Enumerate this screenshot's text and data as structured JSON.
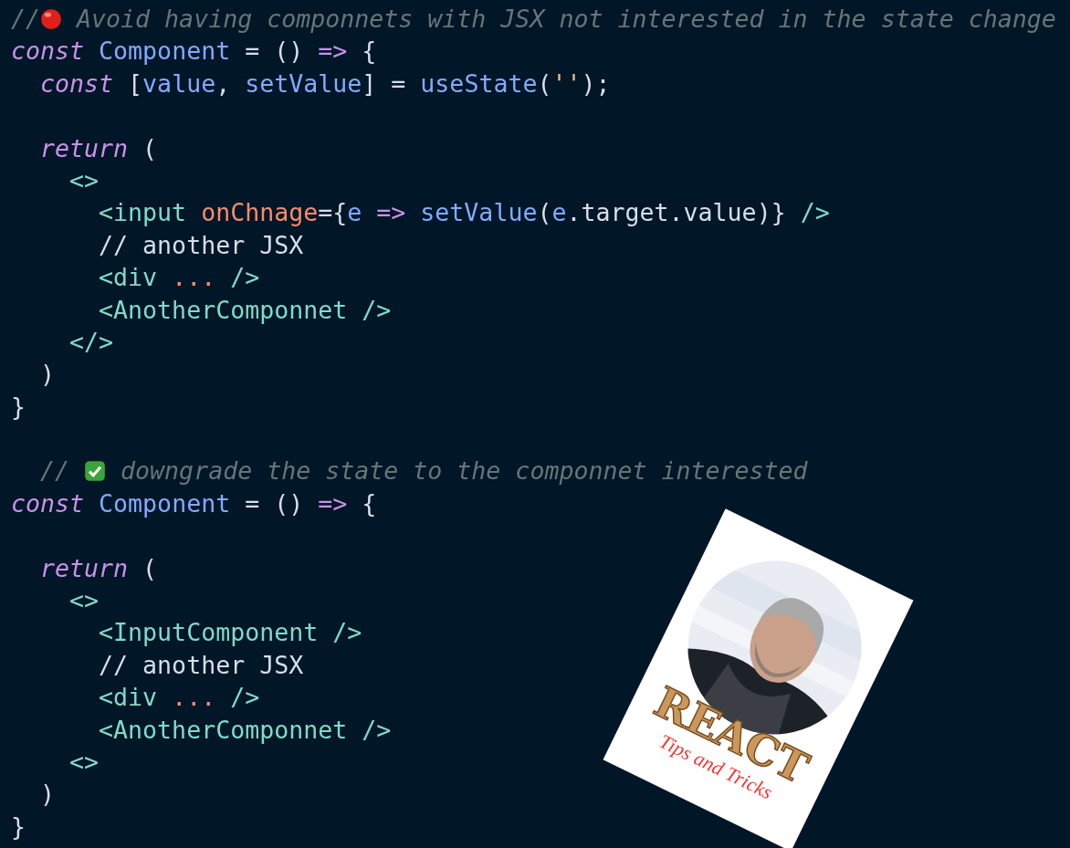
{
  "code_lines": [
    {
      "kind": "code",
      "tokens": [
        {
          "kind": "comment",
          "text": "//"
        },
        {
          "kind": "red-dot"
        },
        {
          "kind": "comment",
          "text": " Avoid having componnets with JSX not interested in the state change"
        }
      ]
    },
    {
      "kind": "code",
      "tokens": [
        {
          "kind": "keyword",
          "text": "const"
        },
        {
          "kind": "name",
          "text": " Component"
        },
        {
          "kind": "punct",
          "text": " = () "
        },
        {
          "kind": "keyword-plain",
          "text": "=>"
        },
        {
          "kind": "punct",
          "text": " {"
        }
      ]
    },
    {
      "kind": "code",
      "tokens": [
        {
          "kind": "keyword",
          "text": "  const"
        },
        {
          "kind": "punct",
          "text": " ["
        },
        {
          "kind": "name",
          "text": "value"
        },
        {
          "kind": "punct",
          "text": ", "
        },
        {
          "kind": "name",
          "text": "setValue"
        },
        {
          "kind": "punct",
          "text": "] = "
        },
        {
          "kind": "name",
          "text": "useState"
        },
        {
          "kind": "punct",
          "text": "("
        },
        {
          "kind": "string",
          "text": "''"
        },
        {
          "kind": "punct",
          "text": ");"
        }
      ]
    },
    {
      "kind": "blank"
    },
    {
      "kind": "code",
      "tokens": [
        {
          "kind": "keyword",
          "text": "  return"
        },
        {
          "kind": "punct",
          "text": " ("
        }
      ]
    },
    {
      "kind": "code",
      "tokens": [
        {
          "kind": "tag",
          "text": "    <>"
        }
      ]
    },
    {
      "kind": "code",
      "tokens": [
        {
          "kind": "tag",
          "text": "      <input "
        },
        {
          "kind": "attr",
          "text": "onChnage"
        },
        {
          "kind": "punct",
          "text": "={"
        },
        {
          "kind": "name",
          "text": "e"
        },
        {
          "kind": "keyword-plain",
          "text": " => "
        },
        {
          "kind": "name",
          "text": "setValue"
        },
        {
          "kind": "punct",
          "text": "("
        },
        {
          "kind": "name",
          "text": "e"
        },
        {
          "kind": "punct",
          "text": "."
        },
        {
          "kind": "plain",
          "text": "target"
        },
        {
          "kind": "punct",
          "text": "."
        },
        {
          "kind": "plain",
          "text": "value"
        },
        {
          "kind": "punct",
          "text": ")} "
        },
        {
          "kind": "tag",
          "text": "/>"
        }
      ]
    },
    {
      "kind": "code",
      "tokens": [
        {
          "kind": "plain",
          "text": "      // another JSX"
        }
      ]
    },
    {
      "kind": "code",
      "tokens": [
        {
          "kind": "tag",
          "text": "      <div "
        },
        {
          "kind": "attr",
          "text": "..."
        },
        {
          "kind": "tag",
          "text": " />"
        }
      ]
    },
    {
      "kind": "code",
      "tokens": [
        {
          "kind": "tag",
          "text": "      <AnotherComponnet />"
        }
      ]
    },
    {
      "kind": "code",
      "tokens": [
        {
          "kind": "tag",
          "text": "    </>"
        }
      ]
    },
    {
      "kind": "code",
      "tokens": [
        {
          "kind": "punct",
          "text": "  )"
        }
      ]
    },
    {
      "kind": "code",
      "tokens": [
        {
          "kind": "punct",
          "text": "}"
        }
      ]
    },
    {
      "kind": "blank"
    },
    {
      "kind": "code",
      "tokens": [
        {
          "kind": "comment",
          "text": "  // "
        },
        {
          "kind": "check"
        },
        {
          "kind": "comment",
          "text": " downgrade the state to the componnet interested"
        }
      ]
    },
    {
      "kind": "code",
      "tokens": [
        {
          "kind": "keyword",
          "text": "const"
        },
        {
          "kind": "name",
          "text": " Component"
        },
        {
          "kind": "punct",
          "text": " = () "
        },
        {
          "kind": "keyword-plain",
          "text": "=>"
        },
        {
          "kind": "punct",
          "text": " {"
        }
      ]
    },
    {
      "kind": "blank"
    },
    {
      "kind": "code",
      "tokens": [
        {
          "kind": "keyword",
          "text": "  return"
        },
        {
          "kind": "punct",
          "text": " ("
        }
      ]
    },
    {
      "kind": "code",
      "tokens": [
        {
          "kind": "tag",
          "text": "    <>"
        }
      ]
    },
    {
      "kind": "code",
      "tokens": [
        {
          "kind": "tag",
          "text": "      <InputComponent />"
        }
      ]
    },
    {
      "kind": "code",
      "tokens": [
        {
          "kind": "plain",
          "text": "      // another JSX"
        }
      ]
    },
    {
      "kind": "code",
      "tokens": [
        {
          "kind": "tag",
          "text": "      <div "
        },
        {
          "kind": "attr",
          "text": "..."
        },
        {
          "kind": "tag",
          "text": " />"
        }
      ]
    },
    {
      "kind": "code",
      "tokens": [
        {
          "kind": "tag",
          "text": "      <AnotherComponnet />"
        }
      ]
    },
    {
      "kind": "code",
      "tokens": [
        {
          "kind": "tag",
          "text": "    <>"
        }
      ]
    },
    {
      "kind": "code",
      "tokens": [
        {
          "kind": "punct",
          "text": "  )"
        }
      ]
    },
    {
      "kind": "code",
      "tokens": [
        {
          "kind": "punct",
          "text": "}"
        }
      ]
    }
  ],
  "card": {
    "title": "REACT",
    "subtitle": "Tips and Tricks"
  }
}
